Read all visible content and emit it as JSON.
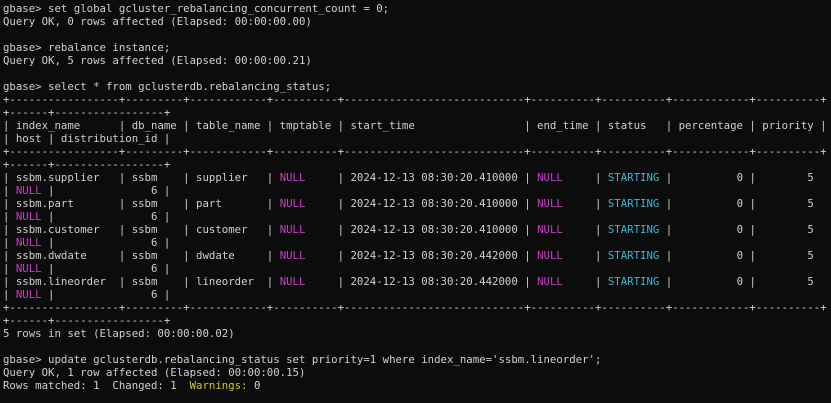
{
  "colors": {
    "background": "#0c0c0c",
    "text": "#d0d0d0",
    "null": "#d03ad0",
    "starting": "#3ab8d8",
    "warnings": "#d8c820"
  },
  "lines": [
    {
      "segments": [
        {
          "t": "gbase> set global gcluster_rebalancing_concurrent_count = 0;"
        }
      ]
    },
    {
      "segments": [
        {
          "t": "Query OK, 0 rows affected (Elapsed: 00:00:00.00)"
        }
      ]
    },
    {
      "segments": [
        {
          "t": ""
        }
      ]
    },
    {
      "segments": [
        {
          "t": "gbase> rebalance instance;"
        }
      ]
    },
    {
      "segments": [
        {
          "t": "Query OK, 5 rows affected (Elapsed: 00:00:00.21)"
        }
      ]
    },
    {
      "segments": [
        {
          "t": ""
        }
      ]
    },
    {
      "segments": [
        {
          "t": "gbase> select * from gclusterdb.rebalancing_status;"
        }
      ]
    },
    {
      "segments": [
        {
          "t": "+-----------------+---------+------------+----------+----------------------------+----------+----------+------------+----------+"
        }
      ]
    },
    {
      "segments": [
        {
          "t": "+------+-----------------+"
        }
      ]
    },
    {
      "segments": [
        {
          "t": "| index_name      | db_name | table_name | tmptable | start_time                 | end_time | status   | percentage | priority |"
        }
      ]
    },
    {
      "segments": [
        {
          "t": "| host | distribution_id |"
        }
      ]
    },
    {
      "segments": [
        {
          "t": "+-----------------+---------+------------+----------+----------------------------+----------+----------+------------+----------+"
        }
      ]
    },
    {
      "segments": [
        {
          "t": "+------+-----------------+"
        }
      ]
    },
    {
      "segments": [
        {
          "t": "| ssbm.supplier   | ssbm    | supplier   | "
        },
        {
          "t": "NULL",
          "c": "null"
        },
        {
          "t": "     | 2024-12-13 08:30:20.410000 | "
        },
        {
          "t": "NULL",
          "c": "null"
        },
        {
          "t": "     | "
        },
        {
          "t": "STARTING",
          "c": "starting"
        },
        {
          "t": " |          0 |        5"
        }
      ]
    },
    {
      "segments": [
        {
          "t": "| "
        },
        {
          "t": "NULL",
          "c": "null"
        },
        {
          "t": " |               6 |"
        }
      ]
    },
    {
      "segments": [
        {
          "t": "| ssbm.part       | ssbm    | part       | "
        },
        {
          "t": "NULL",
          "c": "null"
        },
        {
          "t": "     | 2024-12-13 08:30:20.410000 | "
        },
        {
          "t": "NULL",
          "c": "null"
        },
        {
          "t": "     | "
        },
        {
          "t": "STARTING",
          "c": "starting"
        },
        {
          "t": " |          0 |        5"
        }
      ]
    },
    {
      "segments": [
        {
          "t": "| "
        },
        {
          "t": "NULL",
          "c": "null"
        },
        {
          "t": " |               6 |"
        }
      ]
    },
    {
      "segments": [
        {
          "t": "| ssbm.customer   | ssbm    | customer   | "
        },
        {
          "t": "NULL",
          "c": "null"
        },
        {
          "t": "     | 2024-12-13 08:30:20.410000 | "
        },
        {
          "t": "NULL",
          "c": "null"
        },
        {
          "t": "     | "
        },
        {
          "t": "STARTING",
          "c": "starting"
        },
        {
          "t": " |          0 |        5"
        }
      ]
    },
    {
      "segments": [
        {
          "t": "| "
        },
        {
          "t": "NULL",
          "c": "null"
        },
        {
          "t": " |               6 |"
        }
      ]
    },
    {
      "segments": [
        {
          "t": "| ssbm.dwdate     | ssbm    | dwdate     | "
        },
        {
          "t": "NULL",
          "c": "null"
        },
        {
          "t": "     | 2024-12-13 08:30:20.442000 | "
        },
        {
          "t": "NULL",
          "c": "null"
        },
        {
          "t": "     | "
        },
        {
          "t": "STARTING",
          "c": "starting"
        },
        {
          "t": " |          0 |        5"
        }
      ]
    },
    {
      "segments": [
        {
          "t": "| "
        },
        {
          "t": "NULL",
          "c": "null"
        },
        {
          "t": " |               6 |"
        }
      ]
    },
    {
      "segments": [
        {
          "t": "| ssbm.lineorder  | ssbm    | lineorder  | "
        },
        {
          "t": "NULL",
          "c": "null"
        },
        {
          "t": "     | 2024-12-13 08:30:20.442000 | "
        },
        {
          "t": "NULL",
          "c": "null"
        },
        {
          "t": "     | "
        },
        {
          "t": "STARTING",
          "c": "starting"
        },
        {
          "t": " |          0 |        5"
        }
      ]
    },
    {
      "segments": [
        {
          "t": "| "
        },
        {
          "t": "NULL",
          "c": "null"
        },
        {
          "t": " |               6 |"
        }
      ]
    },
    {
      "segments": [
        {
          "t": "+-----------------+---------+------------+----------+----------------------------+----------+----------+------------+----------+"
        }
      ]
    },
    {
      "segments": [
        {
          "t": "+------+-----------------+"
        }
      ]
    },
    {
      "segments": [
        {
          "t": "5 rows in set (Elapsed: 00:00:00.02)"
        }
      ]
    },
    {
      "segments": [
        {
          "t": ""
        }
      ]
    },
    {
      "segments": [
        {
          "t": "gbase> update gclusterdb.rebalancing_status set priority=1 where index_name='ssbm.lineorder';"
        }
      ]
    },
    {
      "segments": [
        {
          "t": "Query OK, 1 row affected (Elapsed: 00:00:00.15)"
        }
      ]
    },
    {
      "segments": [
        {
          "t": "Rows matched: 1  Changed: 1  "
        },
        {
          "t": "Warnings:",
          "c": "warn"
        },
        {
          "t": " 0"
        }
      ]
    }
  ]
}
